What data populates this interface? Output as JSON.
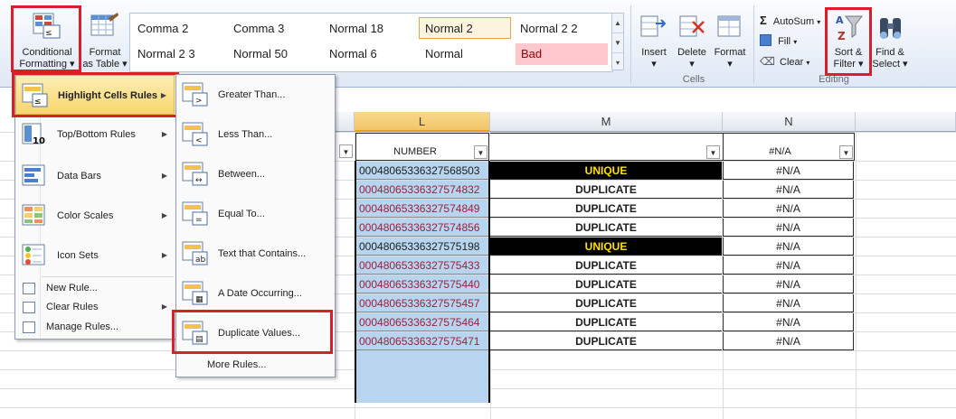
{
  "ribbon": {
    "conditional_formatting": {
      "line1": "Conditional",
      "line2": "Formatting"
    },
    "format_as_table": {
      "line1": "Format",
      "line2": "as Table"
    },
    "cell_styles": [
      [
        "Comma 2",
        "Comma 3",
        "Normal 18",
        "Normal 2",
        "Normal 2 2"
      ],
      [
        "Normal 2 3",
        "Normal 50",
        "Normal 6",
        "Normal",
        "Bad"
      ]
    ],
    "cells_group": {
      "insert": "Insert",
      "delete": "Delete",
      "format": "Format",
      "label": "Cells"
    },
    "editing_group": {
      "autosum": "AutoSum",
      "fill": "Fill",
      "clear": "Clear",
      "sort_line1": "Sort &",
      "sort_line2": "Filter",
      "find_line1": "Find &",
      "find_line2": "Select",
      "label": "Editing"
    }
  },
  "colors": {
    "highlight_red": "#d9202a",
    "duplicate_fill": "#b7d5ef",
    "duplicate_text": "#9c1f3a",
    "bad_fill": "#ffc7ce",
    "menu_hover": "#fbe48f"
  },
  "cf_menu": {
    "items": [
      {
        "label": "Highlight Cells Rules",
        "icon": "highlight-cells-icon"
      },
      {
        "label": "Top/Bottom Rules",
        "icon": "top-bottom-icon"
      },
      {
        "label": "Data Bars",
        "icon": "data-bars-icon"
      },
      {
        "label": "Color Scales",
        "icon": "color-scales-icon"
      },
      {
        "label": "Icon Sets",
        "icon": "icon-sets-icon"
      }
    ],
    "small_items": [
      "New Rule...",
      "Clear Rules",
      "Manage Rules..."
    ]
  },
  "sub_menu": {
    "items": [
      "Greater Than...",
      "Less Than...",
      "Between...",
      "Equal To...",
      "Text that Contains...",
      "A Date Occurring...",
      "Duplicate Values..."
    ],
    "more": "More Rules..."
  },
  "grid": {
    "columns": [
      "L",
      "M",
      "N"
    ],
    "header": {
      "L": "NUMBER",
      "N": "#N/A"
    },
    "rows": [
      {
        "L": "00048065336327568503",
        "M": "UNIQUE",
        "N": "#N/A",
        "dup": false
      },
      {
        "L": "00048065336327574832",
        "M": "DUPLICATE",
        "N": "#N/A",
        "dup": true
      },
      {
        "L": "00048065336327574849",
        "M": "DUPLICATE",
        "N": "#N/A",
        "dup": true
      },
      {
        "L": "00048065336327574856",
        "M": "DUPLICATE",
        "N": "#N/A",
        "dup": true
      },
      {
        "L": "00048065336327575198",
        "M": "UNIQUE",
        "N": "#N/A",
        "dup": false
      },
      {
        "L": "00048065336327575433",
        "M": "DUPLICATE",
        "N": "#N/A",
        "dup": true
      },
      {
        "L": "00048065336327575440",
        "M": "DUPLICATE",
        "N": "#N/A",
        "dup": true
      },
      {
        "L": "00048065336327575457",
        "M": "DUPLICATE",
        "N": "#N/A",
        "dup": true
      },
      {
        "L": "00048065336327575464",
        "M": "DUPLICATE",
        "N": "#N/A",
        "dup": true
      },
      {
        "L": "00048065336327575471",
        "M": "DUPLICATE",
        "N": "#N/A",
        "dup": true
      }
    ]
  }
}
